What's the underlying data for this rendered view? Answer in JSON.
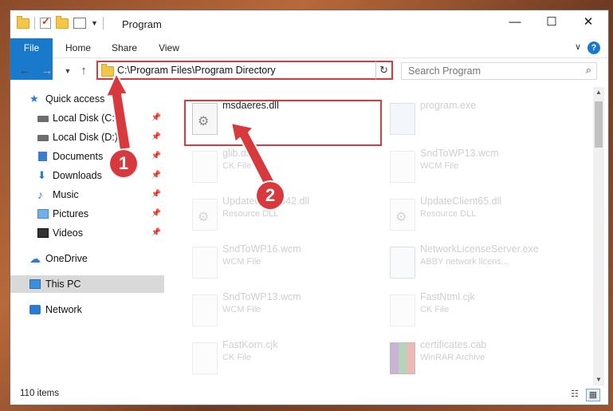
{
  "window": {
    "title": "Program"
  },
  "ribbon": {
    "tabs": [
      "File",
      "Home",
      "Share",
      "View"
    ],
    "help": "?"
  },
  "nav": {
    "address": "C:\\Program Files\\Program Directory",
    "search_placeholder": "Search Program"
  },
  "sidebar": {
    "items": [
      {
        "label": "Quick access",
        "icon": "star-icon"
      },
      {
        "label": "Local Disk (C:)",
        "icon": "drive-icon",
        "pinned": true
      },
      {
        "label": "Local Disk (D:)",
        "icon": "drive-icon",
        "pinned": true
      },
      {
        "label": "Documents",
        "icon": "documents-icon",
        "pinned": true
      },
      {
        "label": "Downloads",
        "icon": "download-icon",
        "pinned": true
      },
      {
        "label": "Music",
        "icon": "music-icon",
        "pinned": true
      },
      {
        "label": "Pictures",
        "icon": "pictures-icon",
        "pinned": true
      },
      {
        "label": "Videos",
        "icon": "videos-icon",
        "pinned": true
      },
      {
        "label": "OneDrive",
        "icon": "cloud-icon"
      },
      {
        "label": "This PC",
        "icon": "pc-icon",
        "selected": true
      },
      {
        "label": "Network",
        "icon": "network-icon"
      }
    ]
  },
  "files": [
    {
      "name": "msdaeres.dll",
      "type": "",
      "icon": "dll-file-icon"
    },
    {
      "name": "program.exe",
      "type": "",
      "icon": "exe-file-icon"
    },
    {
      "name": "glib.dll",
      "type": "CK File",
      "icon": "generic-file-icon"
    },
    {
      "name": "SndToWP13.wcm",
      "type": "WCM File",
      "icon": "generic-file-icon"
    },
    {
      "name": "UpdateClient642.dll",
      "type": "Resource DLL",
      "icon": "dll-file-icon"
    },
    {
      "name": "UpdateClient65.dll",
      "type": "Resource DLL",
      "icon": "dll-file-icon"
    },
    {
      "name": "SndToWP16.wcm",
      "type": "WCM File",
      "icon": "generic-file-icon"
    },
    {
      "name": "NetworkLicenseServer.exe",
      "type": "ABBY network licens...",
      "icon": "exe-file-icon"
    },
    {
      "name": "SndToWP13.wcm",
      "type": "WCM File",
      "icon": "generic-file-icon"
    },
    {
      "name": "FastNtml.cjk",
      "type": "CK File",
      "icon": "generic-file-icon"
    },
    {
      "name": "FastKorn.cjk",
      "type": "CK File",
      "icon": "generic-file-icon"
    },
    {
      "name": "certificates.cab",
      "type": "WinRAR Archive",
      "icon": "archive-file-icon"
    }
  ],
  "status": {
    "count": "110 items"
  },
  "annotations": {
    "one": "1",
    "two": "2"
  },
  "colors": {
    "accent": "#1979ca",
    "highlight": "#d8393d"
  }
}
